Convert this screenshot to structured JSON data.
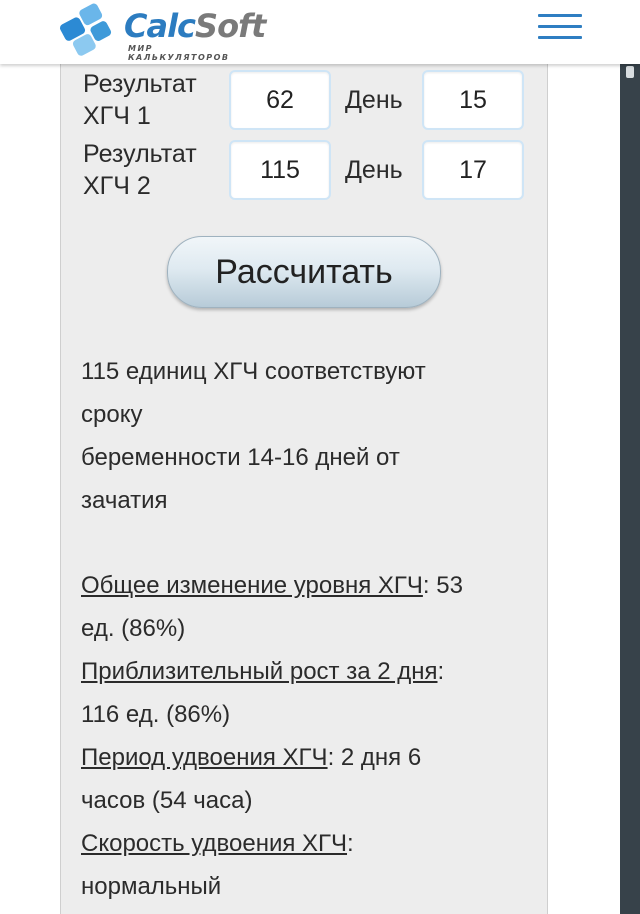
{
  "brand": {
    "name_primary": "Calc",
    "name_secondary": "Soft",
    "subtitle": "МИР КАЛЬКУЛЯТОРОВ"
  },
  "form": {
    "row1": {
      "label_line1": "Результат",
      "label_line2": "ХГЧ 1",
      "value": "62",
      "day_label": "День",
      "day_value": "15"
    },
    "row2": {
      "label_line1": "Результат",
      "label_line2": "ХГЧ 2",
      "value": "115",
      "day_label": "День",
      "day_value": "17"
    },
    "submit_label": "Рассчитать"
  },
  "result": {
    "line1": "115 единиц ХГЧ соответствуют",
    "line2": "сроку",
    "line3": "беременности 14-16 дней от",
    "line4": "зачатия"
  },
  "stats": {
    "total_change_label": "Общее изменение уровня ХГЧ",
    "total_change_value_a": ": 53",
    "total_change_value_b": "ед. (86%)",
    "growth_label": "Приблизительный рост за 2 дня",
    "growth_value_a": ":",
    "growth_value_b": "116 ед. (86%)",
    "doubling_period_label": "Период удвоения ХГЧ",
    "doubling_period_value_a": ": 2 дня 6",
    "doubling_period_value_b": "часов (54 часа)",
    "doubling_speed_label": "Скорость удвоения ХГЧ",
    "doubling_speed_value_a": ":",
    "doubling_speed_value_b": "нормальный"
  },
  "colors": {
    "brand_blue": "#2c7cc0",
    "menu_blue": "#2f7ec2",
    "panel_bg": "#ededed",
    "scrollbar": "#37424a"
  },
  "icons": {
    "logo": "calcsoft-logo-icon",
    "menu": "hamburger-menu-icon"
  }
}
